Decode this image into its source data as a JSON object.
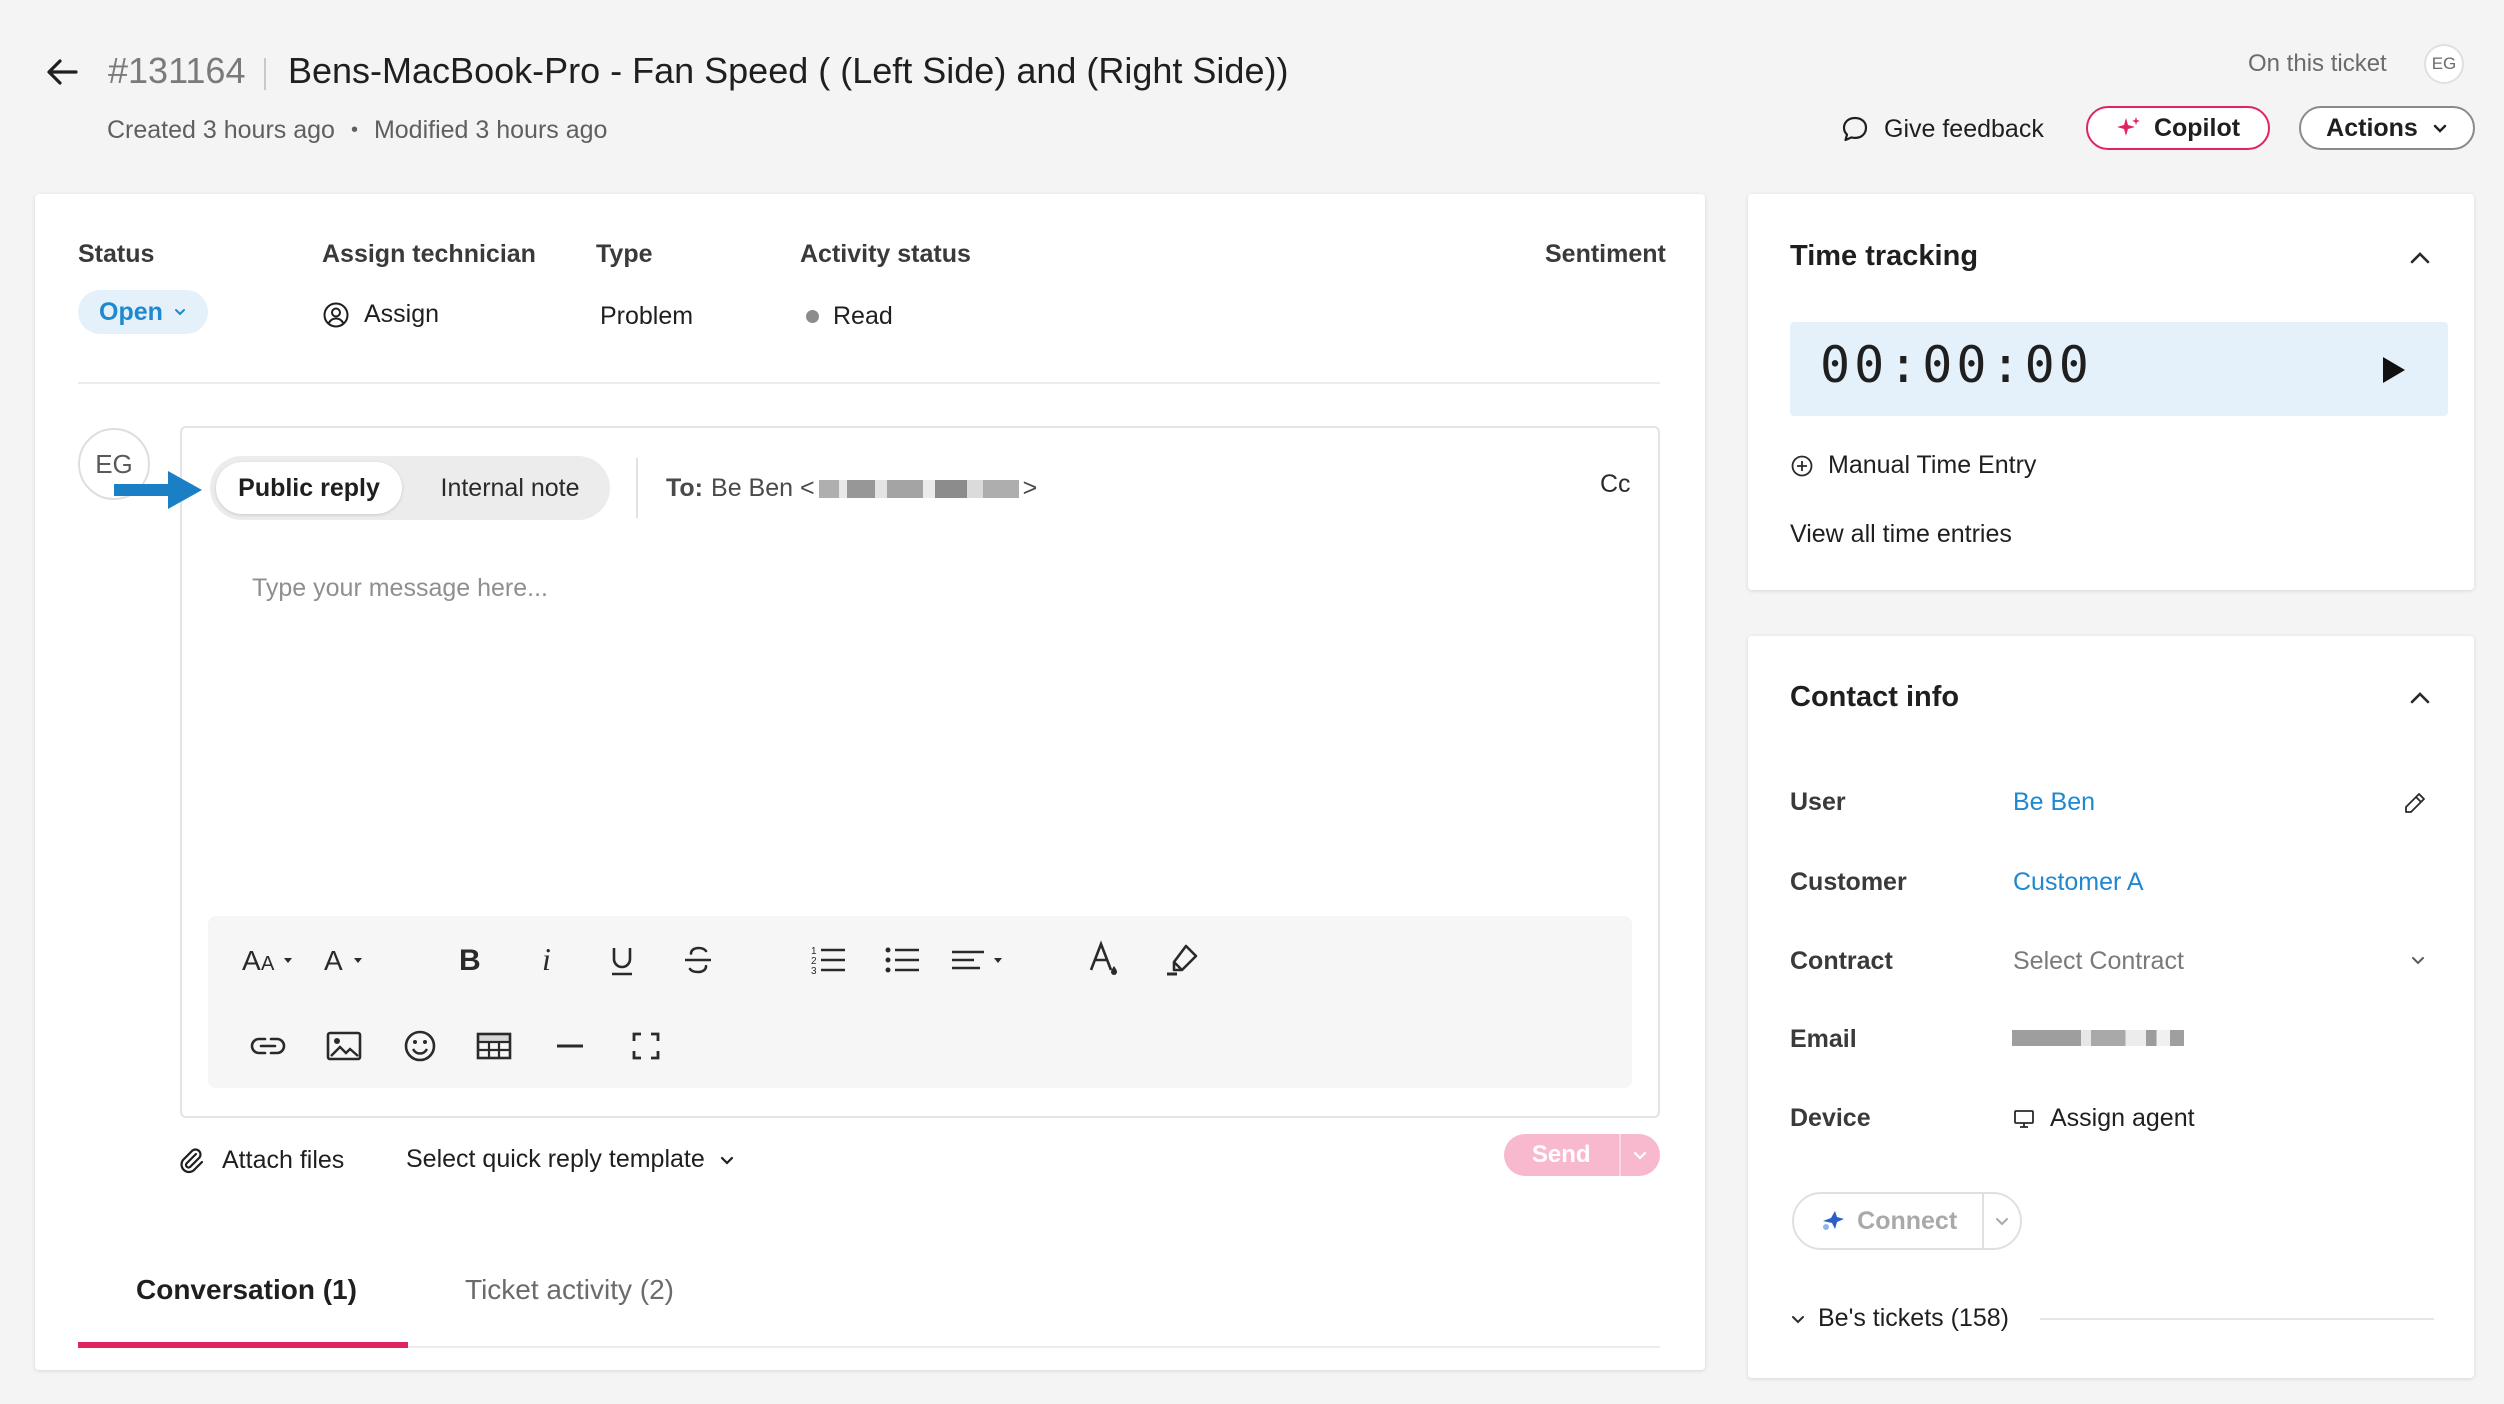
{
  "header": {
    "ticket_id": "#131164",
    "title": "Bens-MacBook-Pro - Fan Speed ( (Left Side) and (Right Side))",
    "created": "Created 3 hours ago",
    "meta_separator": "•",
    "modified": "Modified 3 hours ago",
    "on_this_ticket": "On this ticket",
    "viewer_initials": "EG",
    "give_feedback": "Give feedback",
    "copilot": "Copilot",
    "actions": "Actions"
  },
  "fields": {
    "status_label": "Status",
    "status_value": "Open",
    "assign_label": "Assign technician",
    "assign_value": "Assign",
    "type_label": "Type",
    "type_value": "Problem",
    "activity_label": "Activity status",
    "activity_value": "Read",
    "sentiment_label": "Sentiment"
  },
  "composer": {
    "author_initials": "EG",
    "public_reply": "Public reply",
    "internal_note": "Internal note",
    "to_label": "To:",
    "to_name": "Be Ben <",
    "to_close": ">",
    "cc": "Cc",
    "placeholder": "Type your message here...",
    "attach_files": "Attach files",
    "quick_reply": "Select quick reply template",
    "send": "Send"
  },
  "tabs": {
    "conversation": "Conversation (1)",
    "ticket_activity": "Ticket activity (2)"
  },
  "time_tracking": {
    "title": "Time tracking",
    "timer": "00:00:00",
    "manual_entry": "Manual Time Entry",
    "view_all": "View all time entries"
  },
  "contact_info": {
    "title": "Contact info",
    "user_label": "User",
    "user_value": "Be Ben",
    "customer_label": "Customer",
    "customer_value": "Customer A",
    "contract_label": "Contract",
    "contract_value": "Select Contract",
    "email_label": "Email",
    "device_label": "Device",
    "device_value": "Assign agent",
    "connect": "Connect",
    "tickets": "Be's tickets (158)"
  },
  "colors": {
    "accent_pink": "#e0245e",
    "link_blue": "#1e88d0",
    "status_bg": "#e4f1fb",
    "send_disabled": "#f8b9cf",
    "arrow_blue": "#1a7fc4"
  }
}
